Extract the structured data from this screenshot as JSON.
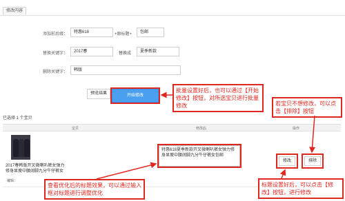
{
  "section": {
    "tab_label": "修改内容"
  },
  "form": {
    "prefix_label": "添加前后缀：",
    "prefix_value": "特惠618",
    "prefix_tag": "+原标题+",
    "suffix_value": "包邮",
    "replace_label": "替换关键字：",
    "replace_from": "2017春",
    "replace_word": "替换成",
    "replace_to": "夏季新款",
    "delete_label": "删除关键字：",
    "delete_value": "韩版"
  },
  "actions": {
    "preview_label": "预览结果",
    "start_label": "开始修改"
  },
  "selection": {
    "count_text": "已选择 1 个宝贝"
  },
  "table": {
    "headers": [
      "宝贝",
      "修改后",
      "操作"
    ],
    "rows": [
      {
        "product_title": "2017春韩版开叉微喇叭裤女弹力修身显瘦中腰阔脚九分牛仔裤女",
        "new_title": "特惠618夏季新款开叉微喇叭裤女弹力修身显瘦中腰阔脚九分牛仔裤女包邮",
        "edit_button": "修改",
        "remove_button": "排除",
        "edit_text": "编辑："
      }
    ]
  },
  "annotations": {
    "batch_note": "批量设置好后，也可以通过【开始修改】按钮，对所选宝贝进行批量修改",
    "exclude_note": "若宝贝不想修改，可以点击【排除】按钮",
    "preview_note": "查看优化后的标题效果，可以通过输入框对标题进行调整优化",
    "edit_note": "标题设置好后，可以点击【修改】按钮，进行修改"
  },
  "colors": {
    "accent": "#4a9ff0",
    "annotation": "#e0271f"
  }
}
